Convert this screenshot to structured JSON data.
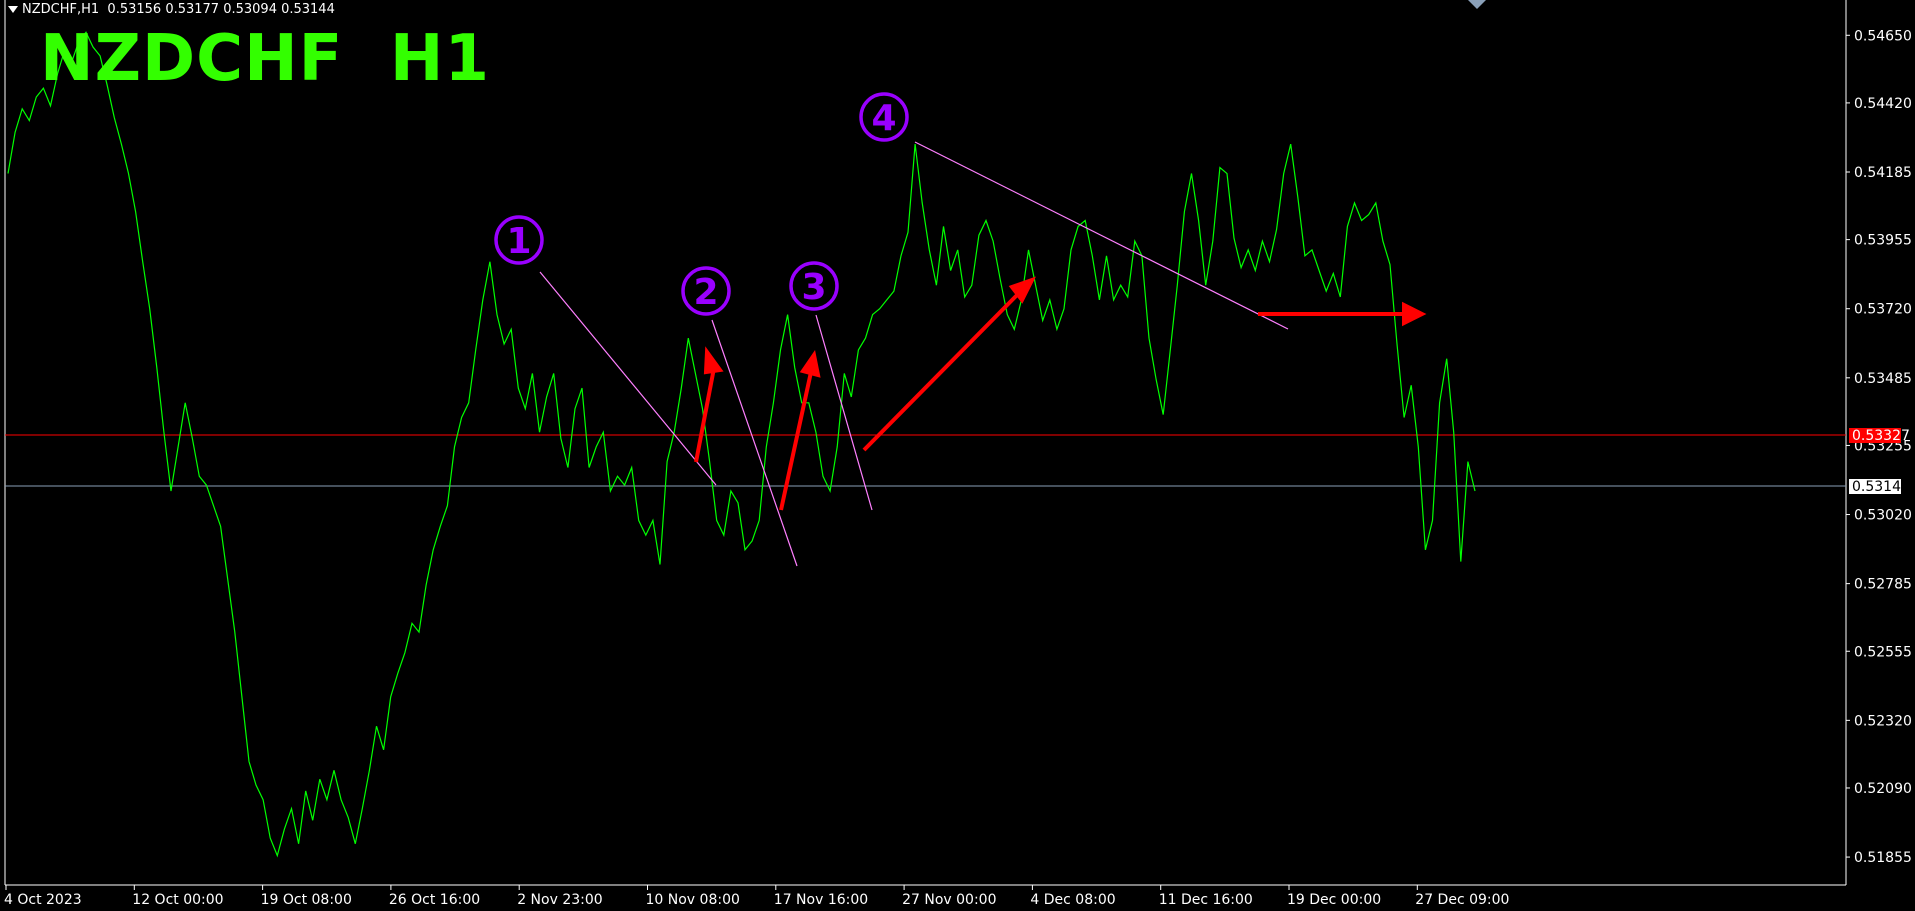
{
  "header": {
    "symbol_info": "NZDCHF,H1",
    "ohlc": "0.53156 0.53177 0.53094 0.53144"
  },
  "title_overlay": "NZDCHF  H1",
  "colors": {
    "background": "#000000",
    "price_line": "#00ff00",
    "trendline": "#ff80ff",
    "arrows": "#ff0000",
    "labels": "#9900ff",
    "title": "#33ff00",
    "red_level": "#ff0000",
    "bid_level": "#8aa0b8"
  },
  "chart_data": {
    "type": "line",
    "title": "NZDCHF  H1",
    "y_ticks": [
      "0.54650",
      "0.54420",
      "0.54185",
      "0.53955",
      "0.53720",
      "0.53485",
      "0.53255",
      "0.53020",
      "0.52785",
      "0.52555",
      "0.52320",
      "0.52090",
      "0.51855"
    ],
    "x_ticks": [
      "4 Oct 2023",
      "12 Oct 00:00",
      "19 Oct 08:00",
      "26 Oct 16:00",
      "2 Nov 23:00",
      "10 Nov 08:00",
      "17 Nov 16:00",
      "27 Nov 00:00",
      "4 Dec 08:00",
      "11 Dec 16:00",
      "19 Dec 00:00",
      "27 Dec 09:00"
    ],
    "ylim": [
      0.5176,
      0.5477
    ],
    "grid": false,
    "series": [
      {
        "values": [
          0.5418,
          0.5432,
          0.544,
          0.5436,
          0.5444,
          0.5447,
          0.5441,
          0.5452,
          0.546,
          0.5456,
          0.5463,
          0.5466,
          0.5461,
          0.5458,
          0.5448,
          0.5437,
          0.5428,
          0.5418,
          0.5405,
          0.5388,
          0.5372,
          0.5352,
          0.533,
          0.531,
          0.5325,
          0.534,
          0.5328,
          0.5315,
          0.5312,
          0.5305,
          0.5298,
          0.528,
          0.5262,
          0.524,
          0.5218,
          0.521,
          0.5205,
          0.5192,
          0.5186,
          0.5195,
          0.5202,
          0.519,
          0.5208,
          0.5198,
          0.5212,
          0.5205,
          0.5215,
          0.5205,
          0.5199,
          0.519,
          0.5202,
          0.5215,
          0.523,
          0.5222,
          0.524,
          0.5248,
          0.5255,
          0.5265,
          0.5262,
          0.5278,
          0.529,
          0.5298,
          0.5305,
          0.5325,
          0.5335,
          0.534,
          0.5358,
          0.5375,
          0.5388,
          0.537,
          0.536,
          0.5365,
          0.5345,
          0.5338,
          0.535,
          0.533,
          0.5342,
          0.535,
          0.5328,
          0.5318,
          0.5338,
          0.5345,
          0.5318,
          0.5325,
          0.533,
          0.531,
          0.5315,
          0.5312,
          0.5318,
          0.53,
          0.5295,
          0.53,
          0.5285,
          0.532,
          0.533,
          0.5345,
          0.5362,
          0.535,
          0.5338,
          0.532,
          0.53,
          0.5295,
          0.531,
          0.5306,
          0.529,
          0.5293,
          0.53,
          0.5325,
          0.534,
          0.5358,
          0.537,
          0.5352,
          0.534,
          0.534,
          0.533,
          0.5315,
          0.531,
          0.5325,
          0.535,
          0.5342,
          0.5358,
          0.5362,
          0.537,
          0.5372,
          0.5375,
          0.5378,
          0.539,
          0.5398,
          0.5428,
          0.5408,
          0.5392,
          0.538,
          0.54,
          0.5385,
          0.5392,
          0.5376,
          0.538,
          0.5397,
          0.5402,
          0.5395,
          0.5382,
          0.537,
          0.5365,
          0.5375,
          0.5392,
          0.538,
          0.5368,
          0.5375,
          0.5365,
          0.5372,
          0.5392,
          0.54,
          0.5402,
          0.539,
          0.5375,
          0.539,
          0.5375,
          0.538,
          0.5376,
          0.5395,
          0.539,
          0.5362,
          0.5348,
          0.5336,
          0.5358,
          0.538,
          0.5405,
          0.5418,
          0.5402,
          0.538,
          0.5395,
          0.542,
          0.5418,
          0.5396,
          0.5386,
          0.5392,
          0.5385,
          0.5395,
          0.5388,
          0.5399,
          0.5418,
          0.5428,
          0.541,
          0.539,
          0.5392,
          0.5385,
          0.5378,
          0.5384,
          0.5376,
          0.54,
          0.5408,
          0.5402,
          0.5404,
          0.5408,
          0.5395,
          0.5387,
          0.536,
          0.5335,
          0.5346,
          0.5325,
          0.529,
          0.53,
          0.534,
          0.5355,
          0.533,
          0.5286,
          0.532,
          0.531
        ]
      }
    ]
  },
  "levels": {
    "red_level_label": "0.53327",
    "bid_level_label": "0.53144"
  },
  "annotations": {
    "wave_labels": [
      "①",
      "②",
      "③",
      "④"
    ]
  }
}
